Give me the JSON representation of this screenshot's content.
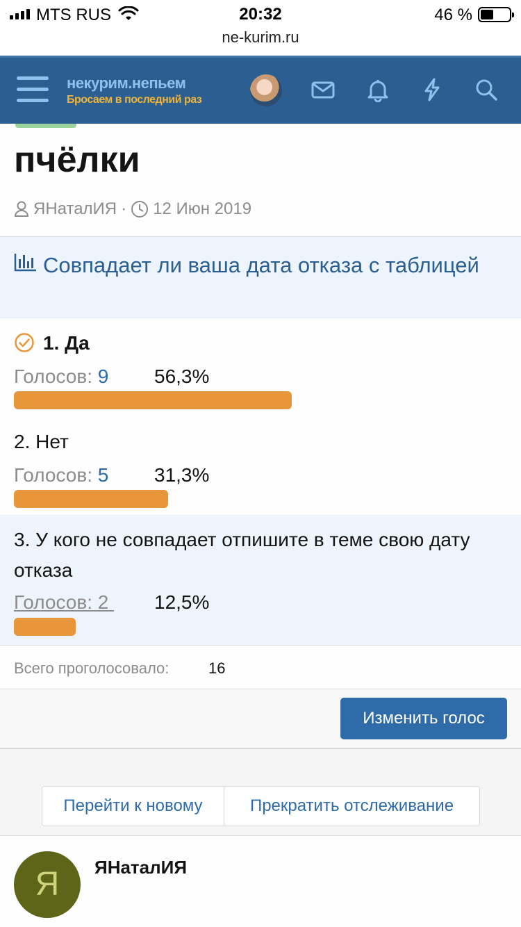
{
  "status_bar": {
    "carrier": "MTS RUS",
    "time": "20:32",
    "battery_percent": "46 %",
    "battery_level": 0.46
  },
  "browser": {
    "url": "ne-kurim.ru"
  },
  "header": {
    "logo_line1": "некурим.непьем",
    "logo_line2": "Бросаем в последний раз"
  },
  "thread": {
    "title": "пчёлки",
    "author": "ЯНаталИЯ",
    "separator": "·",
    "date": "12 Июн 2019"
  },
  "poll": {
    "question": "Совпадает ли ваша дата отказа с таблицей",
    "votes_label": "Голосов:",
    "options": [
      {
        "label": "1. Да",
        "votes": "9",
        "percent": "56,3%",
        "share": 0.563,
        "voted": true
      },
      {
        "label": "2. Нет",
        "votes": "5",
        "percent": "31,3%",
        "share": 0.313,
        "voted": false
      },
      {
        "label": "3. У кого не совпадает отпишите в теме свою дату отказа",
        "votes": "2",
        "percent": "12,5%",
        "share": 0.125,
        "voted": false
      }
    ],
    "total_label": "Всего проголосовало:",
    "total_value": "16",
    "change_vote_label": "Изменить голос"
  },
  "thread_actions": {
    "go_to_new": "Перейти к новому",
    "unwatch": "Прекратить отслеживание"
  },
  "first_post": {
    "avatar_letter": "Я",
    "author": "ЯНаталИЯ"
  },
  "colors": {
    "header_bg": "#2b5f91",
    "accent_blue": "#2f6ba8",
    "bar_orange": "#e8963a",
    "poll_head_bg": "#edf4fb",
    "avatar_bg": "#5e6418"
  }
}
